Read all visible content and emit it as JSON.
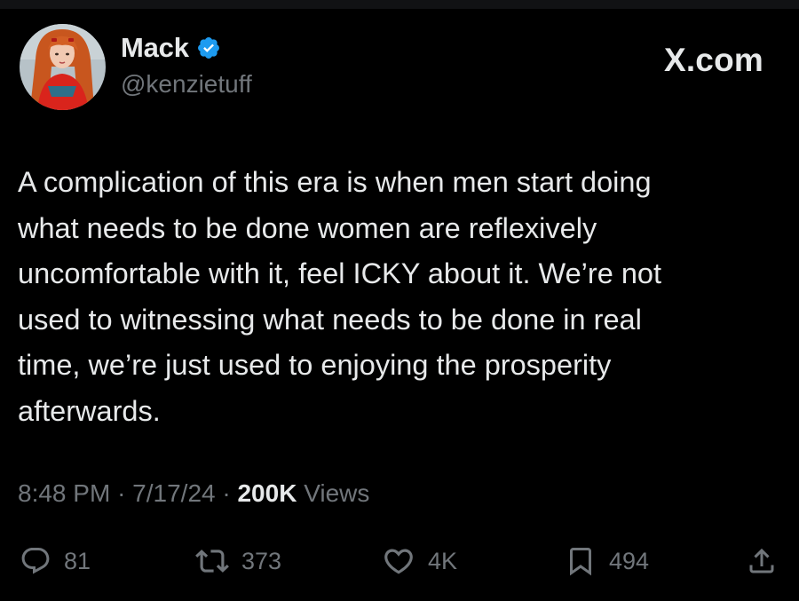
{
  "author": {
    "display_name": "Mack",
    "handle": "@kenzietuff",
    "verified": true,
    "verified_color": "#1d9bf0"
  },
  "brand": "X.com",
  "tweet": {
    "lines": [
      "A complication of this era is when men start doing",
      "what needs to be done women are reflexively",
      "uncomfortable with it, feel ICKY about it. We’re not",
      "used to witnessing what needs to be done in real",
      "time, we’re just used to enjoying the prosperity",
      "afterwards."
    ]
  },
  "meta": {
    "time": "8:48 PM",
    "separator": "·",
    "date": "7/17/24",
    "views_count": "200K",
    "views_label": "Views"
  },
  "actions": {
    "replies": "81",
    "reposts": "373",
    "likes": "4K",
    "bookmarks": "494"
  },
  "icons": {
    "reply": "reply-icon",
    "repost": "repost-icon",
    "like": "heart-icon",
    "bookmark": "bookmark-icon",
    "share": "share-icon"
  },
  "colors": {
    "background": "#000000",
    "text": "#e7e9ea",
    "muted": "#71767b",
    "accent": "#1d9bf0"
  }
}
